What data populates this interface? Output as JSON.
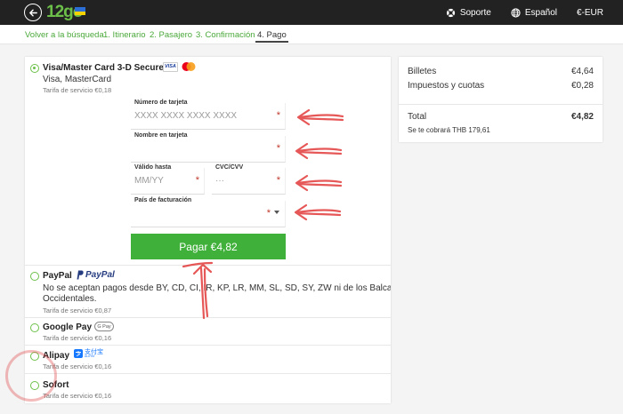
{
  "header": {
    "logo_text": "12go",
    "links": [
      {
        "icon": "lifebuoy-icon",
        "label": "Soporte"
      },
      {
        "icon": "globe-icon",
        "label": "Español"
      },
      {
        "icon": "",
        "label": "€-EUR"
      }
    ]
  },
  "breadcrumbs": [
    {
      "label": "Volver a la búsqueda",
      "active": false
    },
    {
      "label": "1. Itinerario",
      "active": false
    },
    {
      "label": "2. Pasajero",
      "active": false
    },
    {
      "label": "3. Confirmación",
      "active": false
    },
    {
      "label": "4. Pago",
      "active": true
    }
  ],
  "payment": {
    "card": {
      "title": "Visa/Master Card 3-D Secure",
      "subtitle": "Visa, MasterCard",
      "fee": "Tarifa de servicio €0,18",
      "selected": true,
      "visa_label": "VISA",
      "fields": {
        "card_number": {
          "label": "Número de tarjeta",
          "placeholder": "XXXX XXXX XXXX XXXX"
        },
        "card_name": {
          "label": "Nombre en tarjeta",
          "placeholder": ""
        },
        "valid_until": {
          "label": "Válido hasta",
          "placeholder": "MM/YY"
        },
        "cvc": {
          "label": "CVC/CVV",
          "placeholder": "···"
        },
        "country": {
          "label": "País de facturación",
          "placeholder": ""
        }
      },
      "required_mark": "*",
      "pay_button": "Pagar €4,82"
    },
    "paypal": {
      "title": "PayPal",
      "logo_text": "PayPal",
      "note_line1": "No se aceptan pagos desde BY, CD, CI, IR, KP, LR, MM, SL, SD, SY, ZW ni de los Balcanes",
      "note_line2": "Occidentales.",
      "fee": "Tarifa de servicio €0,87"
    },
    "googlepay": {
      "title": "Google Pay",
      "logo_text": "G Pay",
      "fee": "Tarifa de servicio €0,16"
    },
    "alipay": {
      "title": "Alipay",
      "logo_text": "支付宝",
      "logo_sub": "ALIPAY",
      "fee": "Tarifa de servicio €0,16"
    },
    "sofort": {
      "title": "Sofort",
      "fee": "Tarifa de servicio €0,16"
    }
  },
  "summary": {
    "rows": [
      {
        "label": "Billetes",
        "value": "€4,64"
      },
      {
        "label": "Impuestos y cuotas",
        "value": "€0,28"
      }
    ],
    "total_label": "Total",
    "total_value": "€4,82",
    "note": "Se te cobrará THB 179,61"
  },
  "colors": {
    "accent": "#3fb13a",
    "annotation": "#e23a3a",
    "header": "#222222"
  }
}
